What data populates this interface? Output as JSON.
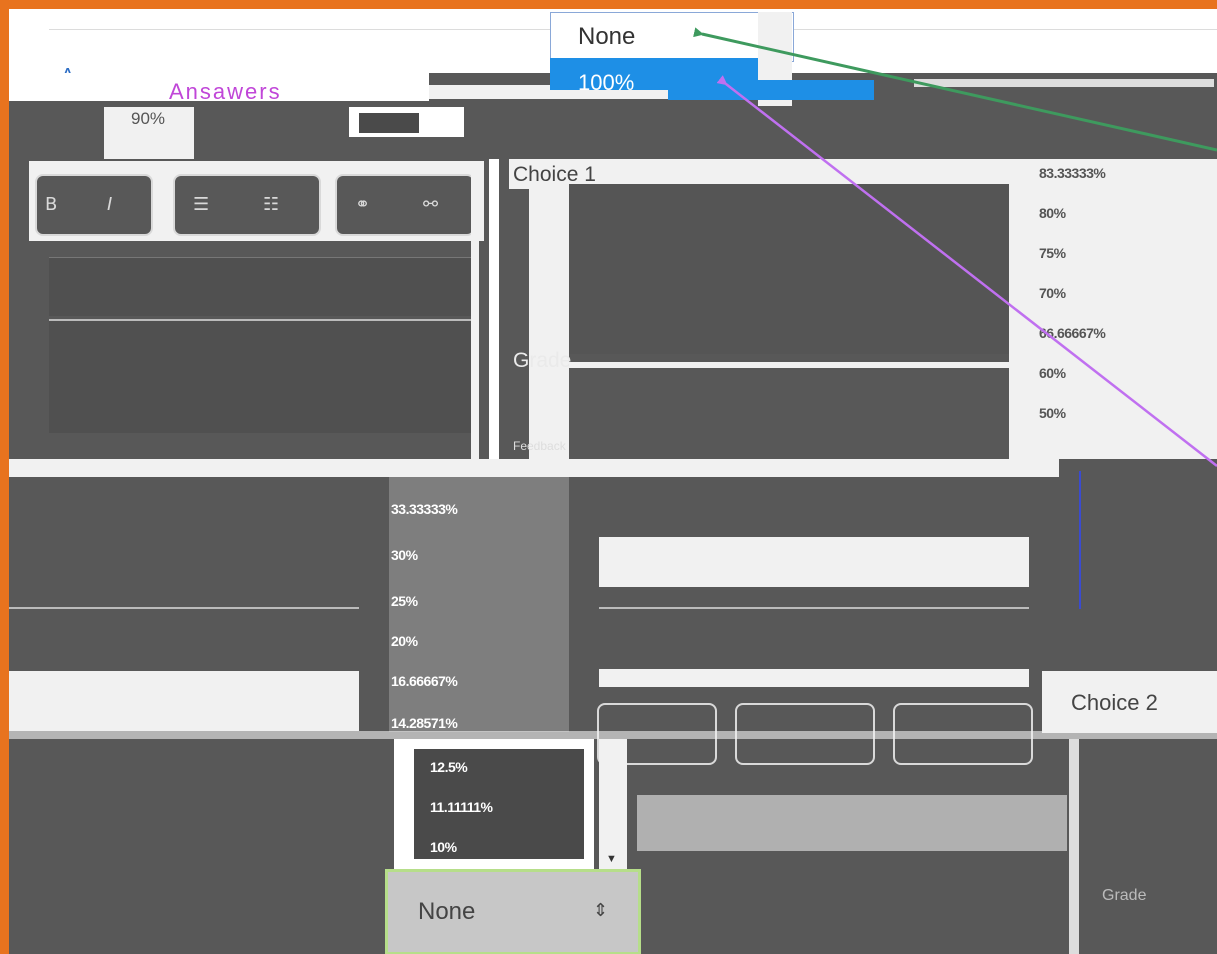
{
  "top_dropdown": {
    "selected": "None",
    "options": [
      "100%",
      "90%"
    ]
  },
  "top_left_label": "Ansawers",
  "choice1": {
    "title": "Choice 1",
    "grade_label": "Grade",
    "feedback_label": "Feedback"
  },
  "right_percent_list": [
    "83.33333%",
    "80%",
    "75%",
    "70%",
    "66.66667%",
    "60%",
    "50%"
  ],
  "mid_percent_list": [
    "33.33333%",
    "30%",
    "25%",
    "20%",
    "16.66667%",
    "14.28571%"
  ],
  "bottom_percent_list": [
    "12.5%",
    "11.11111%",
    "10%"
  ],
  "choice2": {
    "title": "Choice 2",
    "grade_label": "Grade"
  },
  "bottom_select": {
    "value": "None"
  },
  "colors": {
    "slide_background": "#e8731e",
    "dark_panel": "#585858",
    "dropdown_highlight": "#1e8fe6",
    "arrow_green": "#3e9a5e",
    "arrow_purple": "#c070f0",
    "select_border": "#b6de8a"
  }
}
